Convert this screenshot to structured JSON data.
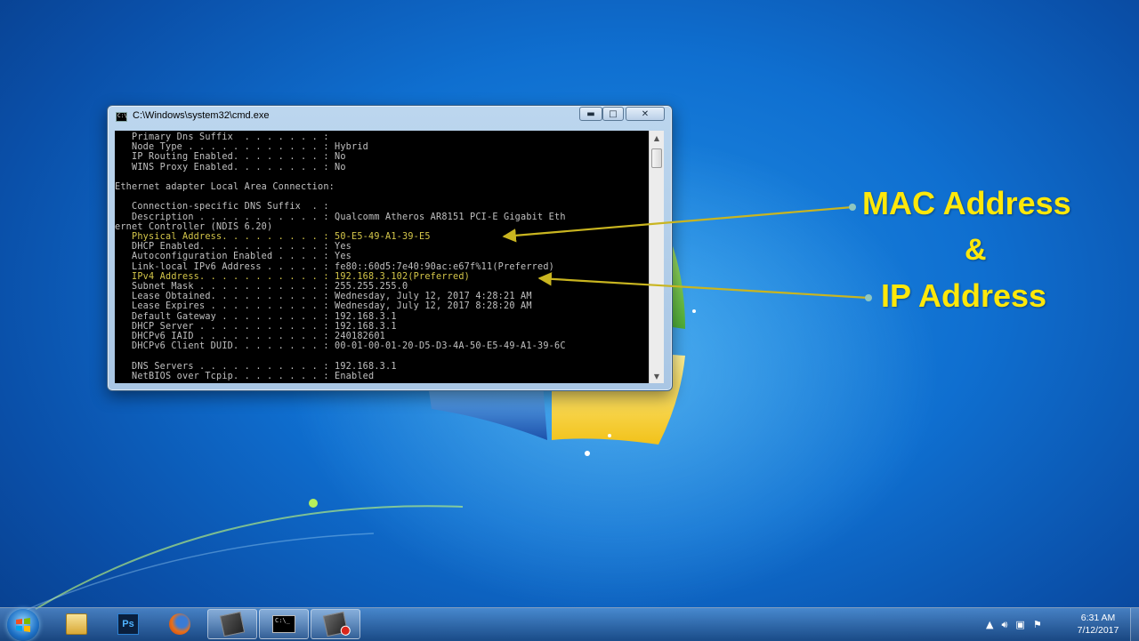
{
  "window": {
    "title": "C:\\Windows\\system32\\cmd.exe",
    "minimize_glyph": "▬",
    "maximize_glyph": "□",
    "close_glyph": "✕"
  },
  "console": {
    "lines": [
      {
        "text": "   Primary Dns Suffix  . . . . . . . : ",
        "highlight": false
      },
      {
        "text": "   Node Type . . . . . . . . . . . . : Hybrid",
        "highlight": false
      },
      {
        "text": "   IP Routing Enabled. . . . . . . . : No",
        "highlight": false
      },
      {
        "text": "   WINS Proxy Enabled. . . . . . . . : No",
        "highlight": false
      },
      {
        "text": "",
        "highlight": false
      },
      {
        "text": "Ethernet adapter Local Area Connection:",
        "highlight": false
      },
      {
        "text": "",
        "highlight": false
      },
      {
        "text": "   Connection-specific DNS Suffix  . : ",
        "highlight": false
      },
      {
        "text": "   Description . . . . . . . . . . . : Qualcomm Atheros AR8151 PCI-E Gigabit Eth",
        "highlight": false
      },
      {
        "text": "ernet Controller (NDIS 6.20)",
        "highlight": false
      },
      {
        "text": "   Physical Address. . . . . . . . . : 50-E5-49-A1-39-E5",
        "highlight": true
      },
      {
        "text": "   DHCP Enabled. . . . . . . . . . . : Yes",
        "highlight": false
      },
      {
        "text": "   Autoconfiguration Enabled . . . . : Yes",
        "highlight": false
      },
      {
        "text": "   Link-local IPv6 Address . . . . . : fe80::60d5:7e40:90ac:e67f%11(Preferred)",
        "highlight": false
      },
      {
        "text": "   IPv4 Address. . . . . . . . . . . : 192.168.3.102(Preferred)",
        "highlight": true
      },
      {
        "text": "   Subnet Mask . . . . . . . . . . . : 255.255.255.0",
        "highlight": false
      },
      {
        "text": "   Lease Obtained. . . . . . . . . . : Wednesday, July 12, 2017 4:28:21 AM",
        "highlight": false
      },
      {
        "text": "   Lease Expires . . . . . . . . . . : Wednesday, July 12, 2017 8:28:20 AM",
        "highlight": false
      },
      {
        "text": "   Default Gateway . . . . . . . . . : 192.168.3.1",
        "highlight": false
      },
      {
        "text": "   DHCP Server . . . . . . . . . . . : 192.168.3.1",
        "highlight": false
      },
      {
        "text": "   DHCPv6 IAID . . . . . . . . . . . : 240182601",
        "highlight": false
      },
      {
        "text": "   DHCPv6 Client DUID. . . . . . . . : 00-01-00-01-20-D5-D3-4A-50-E5-49-A1-39-6C",
        "highlight": false
      },
      {
        "text": "",
        "highlight": false
      },
      {
        "text": "   DNS Servers . . . . . . . . . . . : 192.168.3.1",
        "highlight": false
      },
      {
        "text": "   NetBIOS over Tcpip. . . . . . . . : Enabled",
        "highlight": false
      }
    ],
    "text_color": "#c0c0c0",
    "highlight_color": "#d4c64a"
  },
  "annotations": {
    "mac": "MAC Address",
    "amp": "&",
    "ip": "IP Address",
    "color": "#ffe80a"
  },
  "taskbar": {
    "items": [
      {
        "name": "windows-explorer",
        "icon": "folder-icon"
      },
      {
        "name": "photoshop",
        "icon": "photoshop-icon",
        "label": "Ps"
      },
      {
        "name": "firefox",
        "icon": "firefox-icon"
      },
      {
        "name": "tool",
        "icon": "tool-icon"
      },
      {
        "name": "cmd",
        "icon": "cmd-icon",
        "label": "C:\\_"
      },
      {
        "name": "tool-2",
        "icon": "tool-icon"
      }
    ],
    "tray": {
      "time": "6:31 AM",
      "date": "7/12/2017"
    }
  }
}
